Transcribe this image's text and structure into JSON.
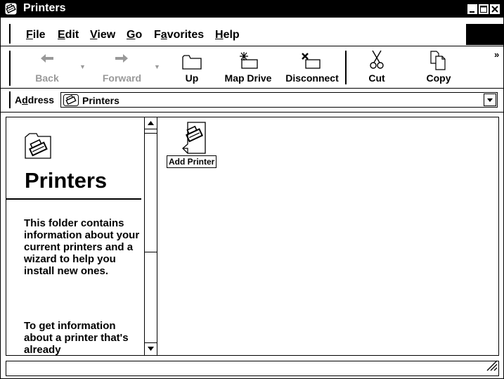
{
  "window": {
    "title": "Printers",
    "title_icon": "printer-icon",
    "controls": [
      "minimize-icon",
      "maximize-icon",
      "close-icon"
    ]
  },
  "menu": {
    "items": [
      {
        "label": "File",
        "accel": "F"
      },
      {
        "label": "Edit",
        "accel": "E"
      },
      {
        "label": "View",
        "accel": "V"
      },
      {
        "label": "Go",
        "accel": "G"
      },
      {
        "label": "Favorites",
        "accel": "a"
      },
      {
        "label": "Help",
        "accel": "H"
      }
    ]
  },
  "toolbar": {
    "back": {
      "label": "Back",
      "icon": "back-arrow-icon",
      "enabled": false
    },
    "forward": {
      "label": "Forward",
      "icon": "forward-arrow-icon",
      "enabled": false
    },
    "up": {
      "label": "Up",
      "icon": "up-folder-icon"
    },
    "map_drive": {
      "label": "Map Drive",
      "icon": "map-drive-icon"
    },
    "disconnect": {
      "label": "Disconnect",
      "icon": "disconnect-drive-icon"
    },
    "cut": {
      "label": "Cut",
      "icon": "scissors-icon"
    },
    "copy": {
      "label": "Copy",
      "icon": "copy-icon"
    },
    "more": "»"
  },
  "address": {
    "label": "Address",
    "value": "Printers",
    "icon": "printer-icon"
  },
  "left_pane": {
    "title": "Printers",
    "icon": "printer-folder-icon",
    "description": "This folder contains information about your current printers and a wizard to help you install new ones.",
    "info": "To get information about a printer that's already"
  },
  "items": [
    {
      "name": "Add Printer",
      "icon": "add-printer-icon"
    }
  ],
  "status": {
    "text": ""
  }
}
